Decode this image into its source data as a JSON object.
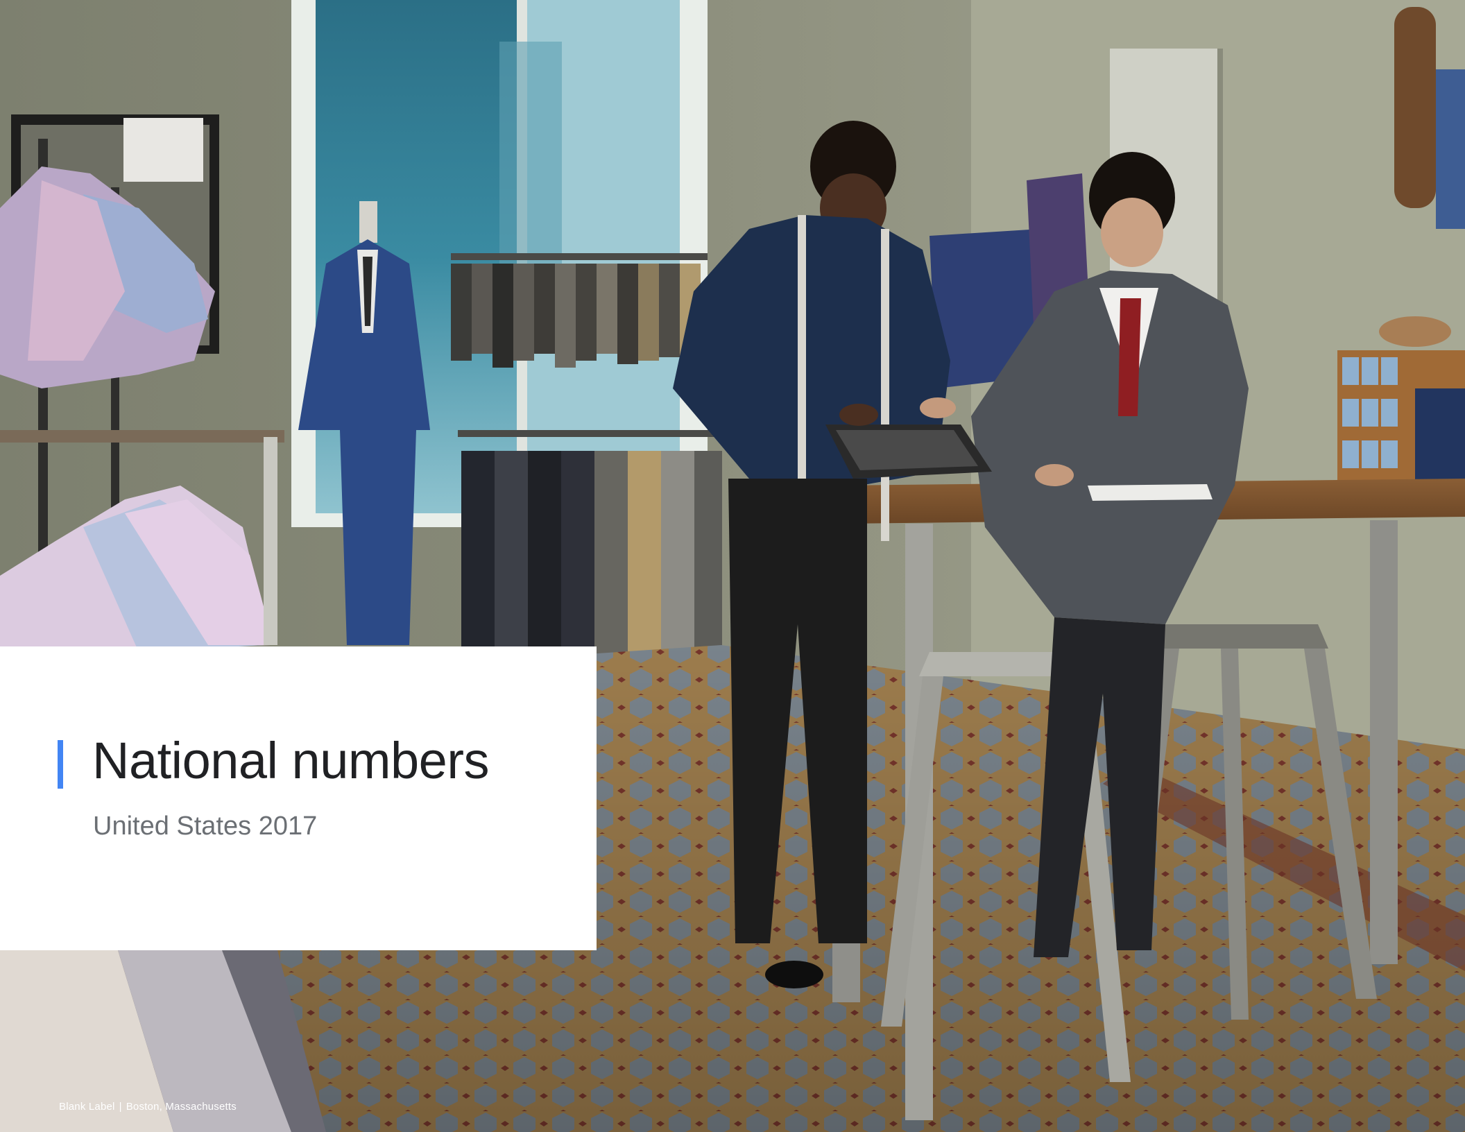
{
  "slide": {
    "title": "National numbers",
    "subtitle": "United States 2017",
    "caption_business": "Blank Label",
    "caption_separator": "|",
    "caption_location": "Boston, Massachusetts"
  },
  "colors": {
    "accent": "#4285f4",
    "title_text": "#202124",
    "subtitle_text": "#6b6f74",
    "card_background": "#ffffff"
  }
}
